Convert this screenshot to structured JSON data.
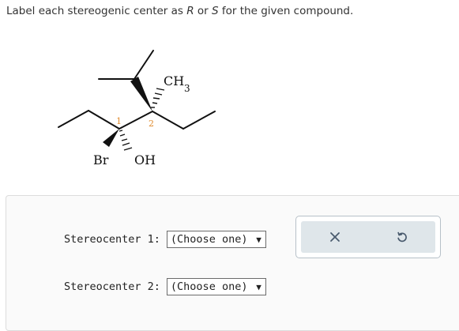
{
  "prompt": {
    "before": "Label each stereogenic center as ",
    "r": "R",
    "middle": " or ",
    "s": "S",
    "after": " for the given compound."
  },
  "molecule": {
    "labels": {
      "methyl_c": "CH",
      "methyl_sub": "3",
      "bromo": "Br",
      "hydroxyl": "OH",
      "center1": "1",
      "center2": "2"
    }
  },
  "stereocenters": [
    {
      "label": "Stereocenter 1:",
      "selected": "(Choose one)"
    },
    {
      "label": "Stereocenter 2:",
      "selected": "(Choose one)"
    }
  ],
  "actions": {
    "clear_icon": "close-icon",
    "undo_icon": "undo-icon",
    "icon_color": "#4a5b6e"
  }
}
